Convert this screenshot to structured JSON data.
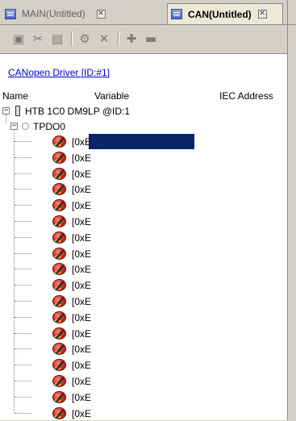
{
  "tabs": [
    {
      "label": "MAIN(Untitled)",
      "active": false,
      "icon": "document-icon"
    },
    {
      "label": "CAN(Untitled)",
      "active": true,
      "icon": "document-icon"
    }
  ],
  "toolbar": {
    "icons": [
      "new-icon",
      "cut-icon",
      "paste-icon",
      "properties-icon",
      "delete-icon",
      "add-icon",
      "remove-icon"
    ]
  },
  "driver_link": "CANopen Driver [ID:#1]",
  "columns": {
    "name": "Name",
    "variable": "Variable",
    "iec": "IEC Address"
  },
  "tree": {
    "device": "HTB 1C0 DM9LP @ID:1",
    "group": "TPDO0",
    "entries": [
      "[0xE",
      "[0xE",
      "[0xE",
      "[0xE",
      "[0xE",
      "[0xE",
      "[0xE",
      "[0xE",
      "[0xE",
      "[0xE",
      "[0xE",
      "[0xE",
      "[0xE",
      "[0xE",
      "[0xE",
      "[0xE",
      "[0xE",
      "[0xE"
    ]
  },
  "colors": {
    "selection": "#0a246a",
    "link": "#0000cc",
    "chrome": "#d4d0c8"
  }
}
